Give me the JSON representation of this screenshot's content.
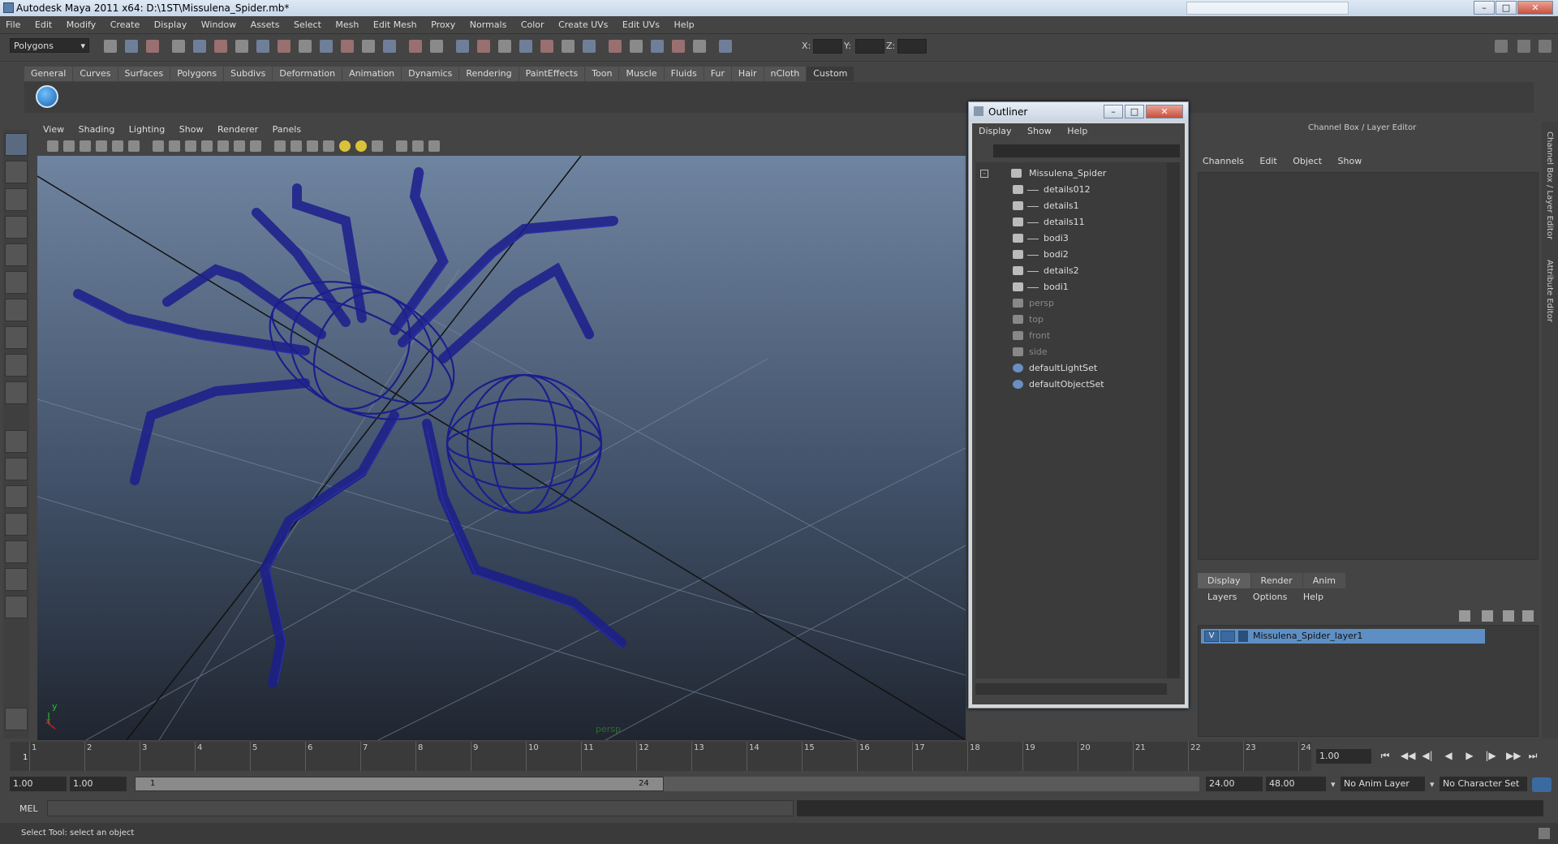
{
  "window": {
    "title": "Autodesk Maya 2011 x64: D:\\1ST\\Missulena_Spider.mb*"
  },
  "menu": [
    "File",
    "Edit",
    "Modify",
    "Create",
    "Display",
    "Window",
    "Assets",
    "Select",
    "Mesh",
    "Edit Mesh",
    "Proxy",
    "Normals",
    "Color",
    "Create UVs",
    "Edit UVs",
    "Help"
  ],
  "status_line": {
    "mode": "Polygons",
    "x_label": "X:",
    "y_label": "Y:",
    "z_label": "Z:"
  },
  "shelf_tabs": [
    "General",
    "Curves",
    "Surfaces",
    "Polygons",
    "Subdivs",
    "Deformation",
    "Animation",
    "Dynamics",
    "Rendering",
    "PaintEffects",
    "Toon",
    "Muscle",
    "Fluids",
    "Fur",
    "Hair",
    "nCloth",
    "Custom"
  ],
  "shelf_active": "Custom",
  "viewport": {
    "menu": [
      "View",
      "Shading",
      "Lighting",
      "Show",
      "Renderer",
      "Panels"
    ],
    "camera_label": "persp",
    "axis_y": "y",
    "axis_x": "x",
    "wire_color": "#1b1e8c"
  },
  "outliner": {
    "title": "Outliner",
    "menu": [
      "Display",
      "Show",
      "Help"
    ],
    "items": [
      {
        "label": "Missulena_Spider",
        "type": "transform",
        "dim": false
      },
      {
        "label": "details012",
        "type": "mesh",
        "dim": false
      },
      {
        "label": "details1",
        "type": "mesh",
        "dim": false
      },
      {
        "label": "details11",
        "type": "mesh",
        "dim": false
      },
      {
        "label": "bodi3",
        "type": "mesh",
        "dim": false
      },
      {
        "label": "bodi2",
        "type": "mesh",
        "dim": false
      },
      {
        "label": "details2",
        "type": "mesh",
        "dim": false
      },
      {
        "label": "bodi1",
        "type": "mesh",
        "dim": false
      },
      {
        "label": "persp",
        "type": "camera",
        "dim": true
      },
      {
        "label": "top",
        "type": "camera",
        "dim": true
      },
      {
        "label": "front",
        "type": "camera",
        "dim": true
      },
      {
        "label": "side",
        "type": "camera",
        "dim": true
      },
      {
        "label": "defaultLightSet",
        "type": "set",
        "dim": false
      },
      {
        "label": "defaultObjectSet",
        "type": "set",
        "dim": false
      }
    ]
  },
  "channel_box": {
    "title": "Channel Box / Layer Editor",
    "menu": [
      "Channels",
      "Edit",
      "Object",
      "Show"
    ],
    "layer_tabs": [
      "Display",
      "Render",
      "Anim"
    ],
    "layer_tab_active": "Display",
    "layer_menu": [
      "Layers",
      "Options",
      "Help"
    ],
    "layer": {
      "visible": "V",
      "name": "Missulena_Spider_layer1"
    },
    "side_tabs": [
      "Channel Box / Layer Editor",
      "Attribute Editor"
    ]
  },
  "timeline": {
    "ticks": [
      1,
      2,
      3,
      4,
      5,
      6,
      7,
      8,
      9,
      10,
      11,
      12,
      13,
      14,
      15,
      16,
      17,
      18,
      19,
      20,
      21,
      22,
      23,
      24
    ],
    "current_frame_marker": "1",
    "current_time": "1.00"
  },
  "range": {
    "start_time": "1.00",
    "playback_start": "1.00",
    "slider_start": "1",
    "slider_end": "24",
    "playback_end": "24.00",
    "end_time": "48.00",
    "anim_layer": "No Anim Layer",
    "character_set": "No Character Set"
  },
  "command_line": {
    "label": "MEL"
  },
  "help_line": {
    "text": "Select Tool: select an object"
  }
}
